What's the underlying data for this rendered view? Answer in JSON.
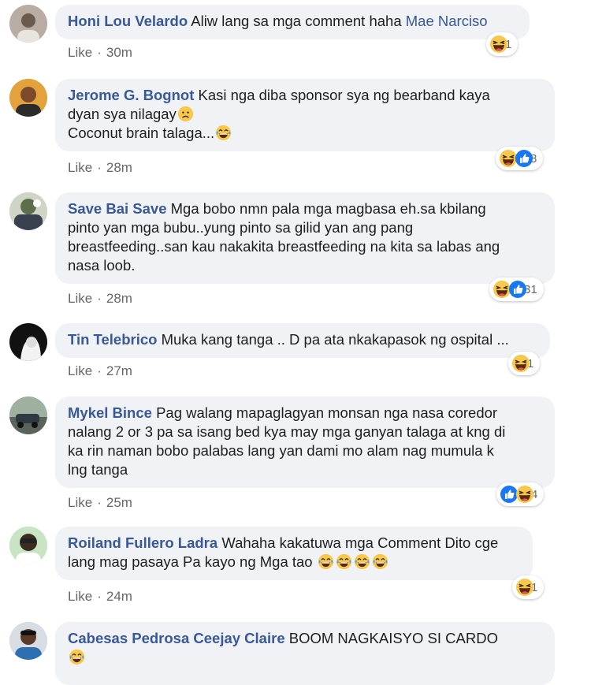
{
  "comments": [
    {
      "author": "Honi Lou Velardo",
      "text": "Aliw lang sa mga comment haha",
      "mention": "Mae Narciso",
      "like_label": "Like",
      "time": "30m",
      "reaction_count": "1"
    },
    {
      "author": "Jerome G. Bognot",
      "text_line1": "Kasi nga diba sponsor sya ng bearband kaya",
      "text_line2": "dyan sya nilagay",
      "text_line3": "Coconut brain talaga...",
      "like_label": "Like",
      "time": "28m",
      "reaction_count": "8"
    },
    {
      "author": "Save Bai Save",
      "text_line1": "Mga bobo nmn pala mga magbasa eh.sa kbilang",
      "text_line2": "pinto yan mga bubu..yung pinto sa gilid yan ang pang",
      "text_line3": "breastfeeding..san kau nakakita breastfeeding na kita sa labas ang",
      "text_line4": "nasa loob.",
      "like_label": "Like",
      "time": "28m",
      "reaction_count": "31"
    },
    {
      "author": "Tin Telebrico",
      "text": "Muka kang tanga .. D pa ata nkakapasok ng ospital ...",
      "like_label": "Like",
      "time": "27m",
      "reaction_count": "1"
    },
    {
      "author": "Mykel Bince",
      "text_line1": "Pag walang mapaglagyan monsan nga nasa coredor",
      "text_line2": "nalang 2 or 3 pa sa isang bed kya may mga ganyan talaga at kng di",
      "text_line3": "ka rin naman bobo palabas lang yan dami mo alam nag mumula k",
      "text_line4": "lng tanga",
      "like_label": "Like",
      "time": "25m",
      "reaction_count": "4"
    },
    {
      "author": "Roiland Fullero Ladra",
      "text_line1": "Wahaha kakatuwa mga Comment Dito cge",
      "text_line2": "lang mag pasaya Pa kayo ng Mga tao",
      "like_label": "Like",
      "time": "24m",
      "reaction_count": "1"
    },
    {
      "author": "Cabesas Pedrosa Ceejay Claire",
      "text": "BOOM NAGKAISYO SI CARDO"
    }
  ],
  "icons": {
    "haha": "haha-reaction-icon",
    "like": "like-reaction-icon",
    "laughing_tears": "laughing-tears-emoji",
    "sad": "sad-emoji"
  },
  "colors": {
    "author": "#385898",
    "bubble": "#f0f2f5",
    "meta": "#65676b",
    "like_blue": "#1877f2",
    "haha_yellow": "#f7c84b"
  }
}
